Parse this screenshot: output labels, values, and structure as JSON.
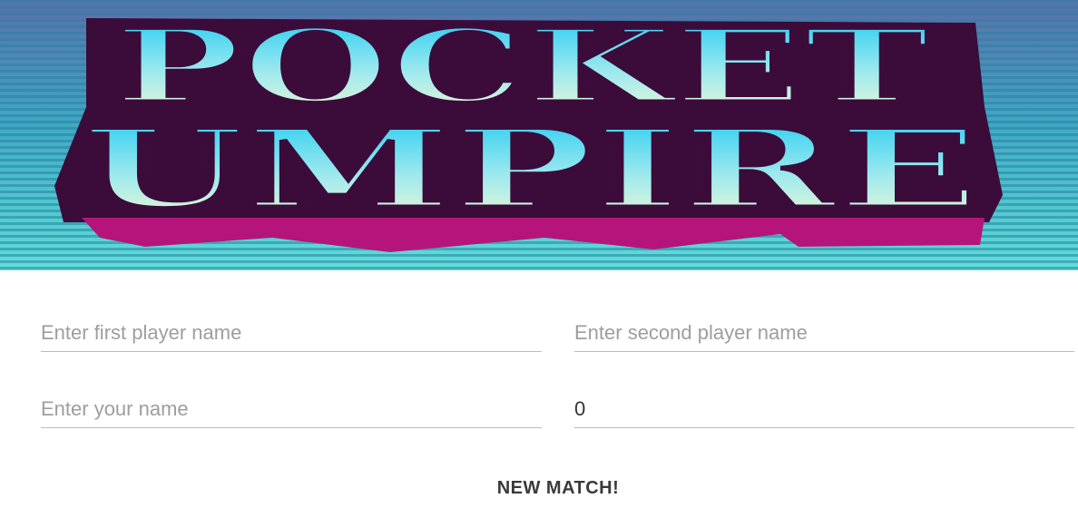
{
  "banner": {
    "title_line1": "POCKET",
    "title_line2": "UMPIRE"
  },
  "form": {
    "first_player": {
      "placeholder": "Enter first player name",
      "value": ""
    },
    "second_player": {
      "placeholder": "Enter second player name",
      "value": ""
    },
    "umpire_name": {
      "placeholder": "Enter your name",
      "value": ""
    },
    "number_field": {
      "value": "0"
    },
    "new_match_label": "NEW MATCH!"
  },
  "colors": {
    "banner_sky": "#4fd2d0",
    "banner_stripe": "#2f8fb0",
    "title_fill_top": "#1ecdf5",
    "title_fill_bottom": "#fbfbd2",
    "title_outline": "#3b0b3a",
    "title_shadow": "#b5157a"
  }
}
